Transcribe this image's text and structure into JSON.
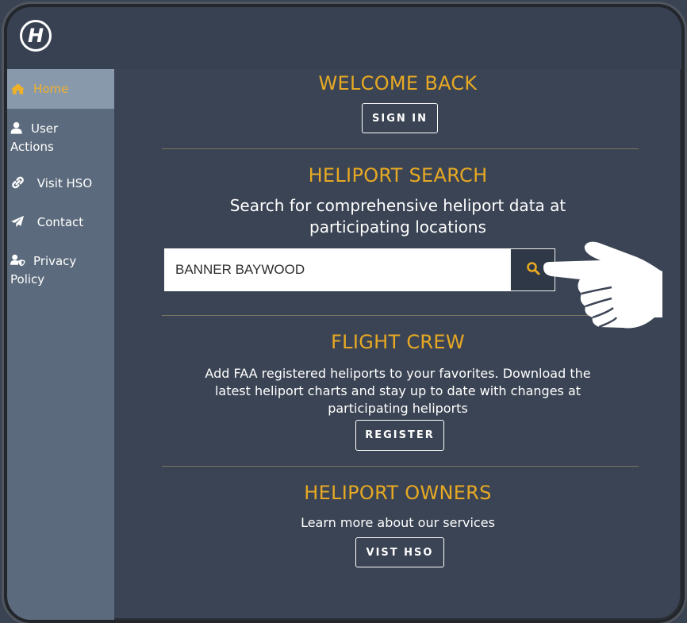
{
  "app": {
    "logo_letter": "H"
  },
  "sidebar": {
    "items": [
      {
        "label": "Home",
        "icon": "home-icon",
        "active": true
      },
      {
        "label": "User\nActions",
        "icon": "user-icon"
      },
      {
        "label": "Visit HSO",
        "icon": "link-icon"
      },
      {
        "label": "Contact",
        "icon": "paper-plane-icon"
      },
      {
        "label": "Privacy\nPolicy",
        "icon": "user-shield-icon"
      }
    ]
  },
  "welcome": {
    "title": "WELCOME BACK",
    "button": "SIGN IN"
  },
  "search": {
    "title": "HELIPORT SEARCH",
    "subtitle_line1": "Search for comprehensive heliport data at",
    "subtitle_line2": "participating locations",
    "value": "BANNER BAYWOOD"
  },
  "crew": {
    "title": "FLIGHT CREW",
    "line1": "Add FAA registered heliports to your favorites. Download the",
    "line2": "latest heliport charts and stay up to date with changes at",
    "line3": "participating heliports",
    "button": "REGISTER"
  },
  "owners": {
    "title": "HELIPORT OWNERS",
    "text": "Learn more about our services",
    "button": "VIST HSO"
  },
  "colors": {
    "accent": "#e7a923",
    "background": "#374152",
    "sidebar": "#5b6a7c",
    "active": "#8999ac"
  }
}
